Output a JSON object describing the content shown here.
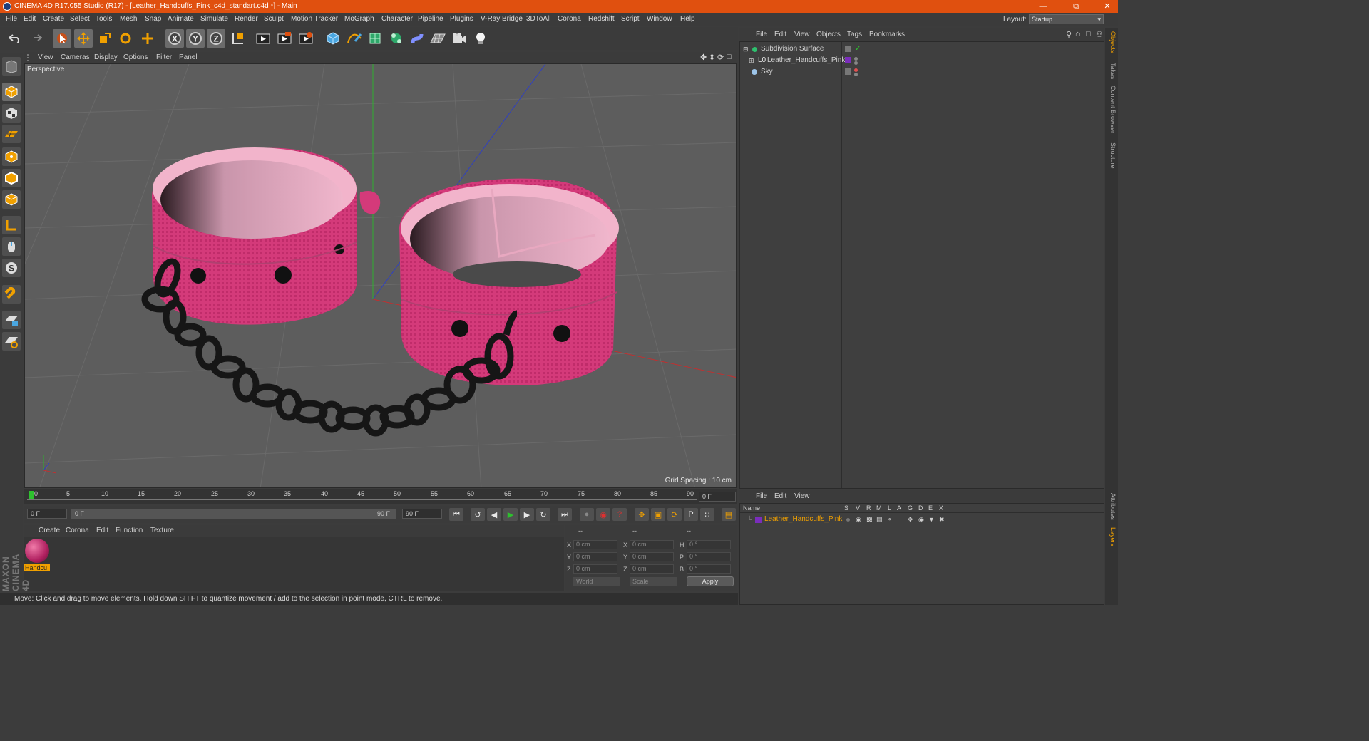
{
  "window": {
    "title": "CINEMA 4D R17.055 Studio (R17) - [Leather_Handcuffs_Pink_c4d_standart.c4d *] - Main"
  },
  "menu": [
    "File",
    "Edit",
    "Create",
    "Select",
    "Tools",
    "Mesh",
    "Snap",
    "Animate",
    "Simulate",
    "Render",
    "Sculpt",
    "Motion Tracker",
    "MoGraph",
    "Character",
    "Pipeline",
    "Plugins",
    "V-Ray Bridge",
    "3DToAll",
    "Corona",
    "Redshift",
    "Script",
    "Window",
    "Help"
  ],
  "layout": {
    "label": "Layout:",
    "value": "Startup"
  },
  "viewport": {
    "menu": [
      "View",
      "Cameras",
      "Display",
      "Options",
      "Filter",
      "Panel"
    ],
    "camera": "Perspective",
    "grid_spacing": "Grid Spacing : 10 cm"
  },
  "timeline": {
    "ticks": [
      "0",
      "5",
      "10",
      "15",
      "20",
      "25",
      "30",
      "35",
      "40",
      "45",
      "50",
      "55",
      "60",
      "65",
      "70",
      "75",
      "80",
      "85",
      "90"
    ],
    "current_frame": "0 F",
    "start": "0 F",
    "range_start": "0 F",
    "range_end": "90 F",
    "end": "90 F"
  },
  "material_manager": {
    "menu": [
      "Create",
      "Corona",
      "Edit",
      "Function",
      "Texture"
    ],
    "material_name": "Handcu"
  },
  "coordinates": {
    "headers": [
      "--",
      "--",
      "--"
    ],
    "rows": [
      {
        "a": "X",
        "av": "0 cm",
        "b": "X",
        "bv": "0 cm",
        "c": "H",
        "cv": "0 °"
      },
      {
        "a": "Y",
        "av": "0 cm",
        "b": "Y",
        "bv": "0 cm",
        "c": "P",
        "cv": "0 °"
      },
      {
        "a": "Z",
        "av": "0 cm",
        "b": "Z",
        "bv": "0 cm",
        "c": "B",
        "cv": "0 °"
      }
    ],
    "mode1": "World",
    "mode2": "Scale",
    "apply": "Apply"
  },
  "status": "Move: Click and drag to move elements. Hold down SHIFT to quantize movement / add to the selection in point mode, CTRL to remove.",
  "object_manager": {
    "menu": [
      "File",
      "Edit",
      "View",
      "Objects",
      "Tags",
      "Bookmarks"
    ],
    "objects": [
      "Subdivision Surface",
      "Leather_Handcuffs_Pink",
      "Sky"
    ]
  },
  "layer_manager": {
    "menu": [
      "File",
      "Edit",
      "View"
    ],
    "columns": [
      "Name",
      "S",
      "V",
      "R",
      "M",
      "L",
      "A",
      "G",
      "D",
      "E",
      "X"
    ],
    "layer": "Leather_Handcuffs_Pink"
  },
  "right_tabs": [
    "Objects",
    "Takes",
    "Content Browser",
    "Structure"
  ],
  "right_tabs_lower": [
    "Attributes",
    "Layers"
  ],
  "brand": "MAXON CINEMA 4D",
  "colors": {
    "titlebar": "#e0500f",
    "accent": "#f0a000",
    "material": "#d43a7a"
  }
}
